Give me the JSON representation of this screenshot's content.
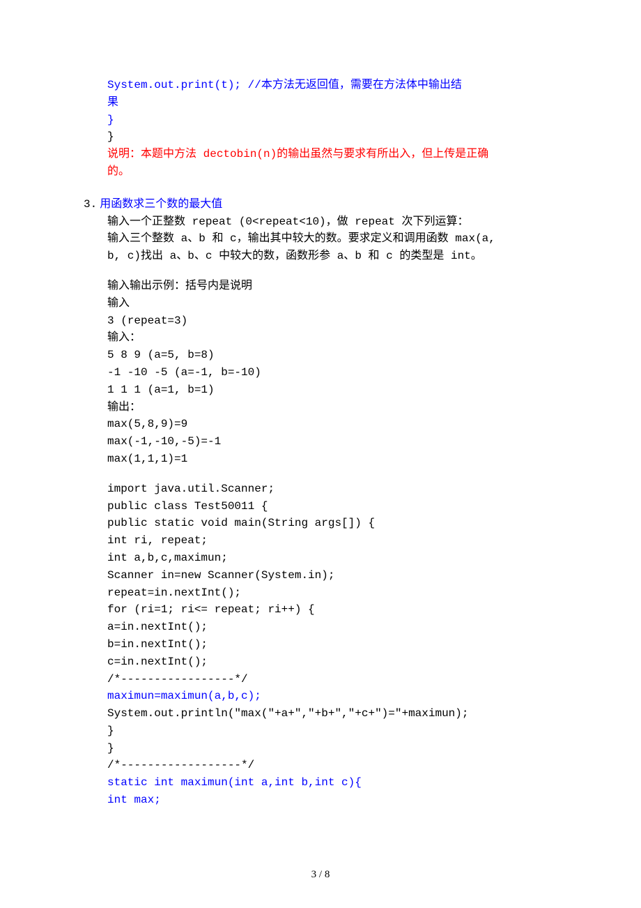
{
  "block1": {
    "line1_a": "       System.out.print(t); //",
    "line1_b": "本方法无返回值，需要在方法体中输出结",
    "line2": "果",
    "line3": "  }",
    "line4": "}",
    "note_a": "说明：本题中方法",
    "note_b": " dectobin(n)",
    "note_c": "的输出虽然与要求有所出入，但上传是正确",
    "note_d": "的。"
  },
  "section3": {
    "number": "3.",
    "title": "用函数求三个数的最大值",
    "desc1_a": "输入一个正整数",
    "desc1_b": " repeat (0<repeat<10)",
    "desc1_c": "，做",
    "desc1_d": " repeat ",
    "desc1_e": "次下列运算：",
    "desc2_a": "输入三个整数",
    "desc2_b": " a",
    "desc2_c": "、",
    "desc2_d": "b ",
    "desc2_e": "和",
    "desc2_f": " c",
    "desc2_g": "，输出其中较大的数。要求定义和调用函数",
    "desc2_h": " max(a, ",
    "desc3_a": "b, c)",
    "desc3_b": "找出",
    "desc3_c": " a",
    "desc3_d": "、",
    "desc3_e": "b",
    "desc3_f": "、",
    "desc3_g": "c ",
    "desc3_h": "中较大的数，函数形参",
    "desc3_i": " a",
    "desc3_j": "、",
    "desc3_k": "b ",
    "desc3_l": "和",
    "desc3_m": " c ",
    "desc3_n": "的类型是",
    "desc3_o": " int",
    "desc3_p": "。",
    "io_title": "输入输出示例：括号内是说明",
    "input_label": "输入",
    "input1": "3       (repeat=3)",
    "input_label2": "输入：",
    "input2": "5 8 9    (a=5, b=8)",
    "input3": "-1 -10 -5  (a=-1, b=-10)",
    "input4": "1 1 1     (a=1, b=1)",
    "output_label": "输出：",
    "output1": "max(5,8,9)=9",
    "output2": "max(-1,-10,-5)=-1",
    "output3": "max(1,1,1)=1",
    "code": {
      "l1": "import java.util.Scanner;",
      "l2": "public class Test50011 {",
      "l3": " public static void main(String args[]) {",
      "l4": "  int ri, repeat;",
      "l5": "  int a,b,c,maximun;",
      "l6": "  Scanner in=new Scanner(System.in);",
      "l7": "  repeat=in.nextInt();",
      "l8": "  for (ri=1; ri<= repeat; ri++) {",
      "l9": "     a=in.nextInt();",
      "l10": "     b=in.nextInt();",
      "l11": "     c=in.nextInt();",
      "l12": "      /*-----------------*/",
      "l13": "     maximun=maximun(a,b,c);",
      "l14": "     System.out.println(\"max(\"+a+\",\"+b+\",\"+c+\")=\"+maximun);",
      "l15": "  }",
      "l16": " }",
      "l17": " /*------------------*/",
      "l18": " static int maximun(int a,int b,int c){",
      "l19": "     int max;"
    }
  },
  "footer": "3 / 8"
}
